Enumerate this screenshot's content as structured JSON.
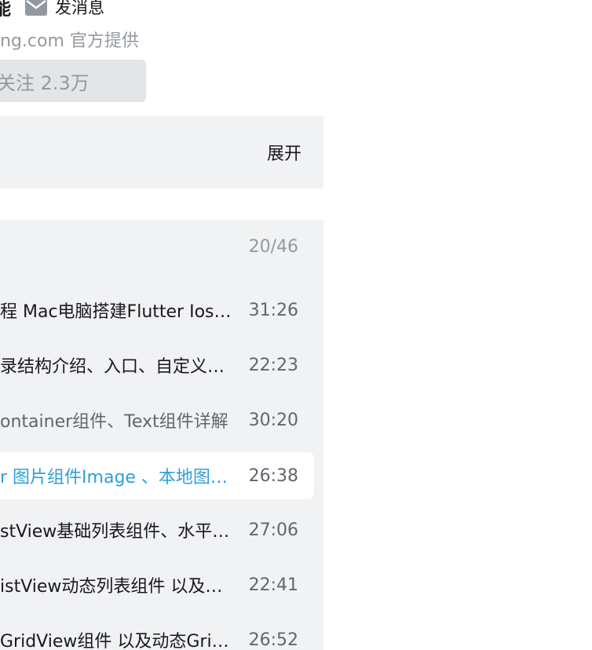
{
  "header": {
    "name_fragment": "能",
    "message_label": "发消息",
    "provider_text": "ng.com 官方提供",
    "follow_label": "关注 2.3万"
  },
  "description": {
    "expand_label": "展开"
  },
  "playlist": {
    "counter": "20/46",
    "episodes": [
      {
        "title": "程 Mac电脑搭建Flutter Ios…",
        "duration": "31:26"
      },
      {
        "title": "录结构介绍、入口、自定义…",
        "duration": "22:23"
      },
      {
        "title": "ontainer组件、Text组件详解",
        "duration": "30:20"
      },
      {
        "title": "r 图片组件Image 、本地图…",
        "duration": "26:38"
      },
      {
        "title": "stView基础列表组件、水平…",
        "duration": "27:06"
      },
      {
        "title": "istView动态列表组件 以及…",
        "duration": "22:41"
      },
      {
        "title": "GridView组件 以及动态Grid…",
        "duration": "26:52"
      }
    ]
  },
  "colors": {
    "accent": "#00aeec",
    "panel_bg": "#f1f2f3",
    "muted_text": "#9499a0"
  }
}
